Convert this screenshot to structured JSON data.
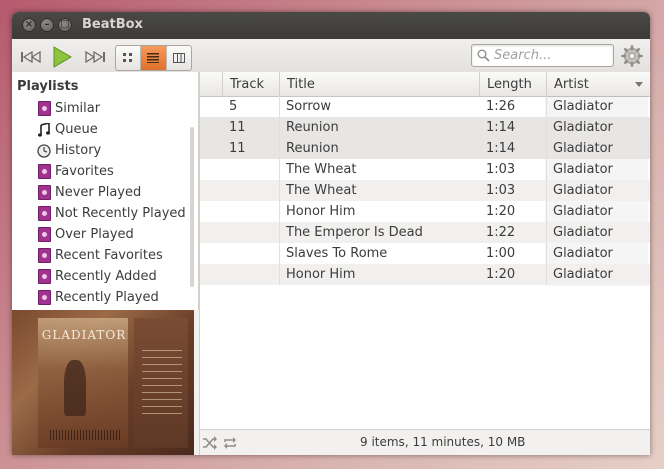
{
  "window": {
    "title": "BeatBox"
  },
  "search": {
    "placeholder": "Search..."
  },
  "sidebar": {
    "heading": "Playlists",
    "items": [
      {
        "label": "Similar",
        "icon": "smart-playlist-icon"
      },
      {
        "label": "Queue",
        "icon": "music-note-icon"
      },
      {
        "label": "History",
        "icon": "clock-icon"
      },
      {
        "label": "Favorites",
        "icon": "smart-playlist-icon"
      },
      {
        "label": "Never Played",
        "icon": "smart-playlist-icon"
      },
      {
        "label": "Not Recently Played",
        "icon": "smart-playlist-icon"
      },
      {
        "label": "Over Played",
        "icon": "smart-playlist-icon"
      },
      {
        "label": "Recent Favorites",
        "icon": "smart-playlist-icon"
      },
      {
        "label": "Recently Added",
        "icon": "smart-playlist-icon"
      },
      {
        "label": "Recently Played",
        "icon": "smart-playlist-icon"
      }
    ]
  },
  "album_art": {
    "title": "GLADIATOR"
  },
  "table": {
    "columns": {
      "track": "Track",
      "title": "Title",
      "length": "Length",
      "artist": "Artist"
    },
    "rows": [
      {
        "track": "5",
        "title": "Sorrow",
        "length": "1:26",
        "artist": "Gladiator"
      },
      {
        "track": "11",
        "title": "Reunion",
        "length": "1:14",
        "artist": "Gladiator"
      },
      {
        "track": "11",
        "title": "Reunion",
        "length": "1:14",
        "artist": "Gladiator"
      },
      {
        "track": "",
        "title": "The Wheat",
        "length": "1:03",
        "artist": "Gladiator"
      },
      {
        "track": "",
        "title": "The Wheat",
        "length": "1:03",
        "artist": "Gladiator"
      },
      {
        "track": "",
        "title": "Honor Him",
        "length": "1:20",
        "artist": "Gladiator"
      },
      {
        "track": "",
        "title": "The Emperor Is Dead",
        "length": "1:22",
        "artist": "Gladiator"
      },
      {
        "track": "",
        "title": "Slaves To Rome",
        "length": "1:00",
        "artist": "Gladiator"
      },
      {
        "track": "",
        "title": "Honor Him",
        "length": "1:20",
        "artist": "Gladiator"
      }
    ]
  },
  "status": {
    "text": "9 items, 11 minutes, 10 MB"
  },
  "colors": {
    "accent": "#e8762f",
    "play": "#8cc43c",
    "playlist_icon": "#a2328f",
    "titlebar": "#3c3b37"
  }
}
